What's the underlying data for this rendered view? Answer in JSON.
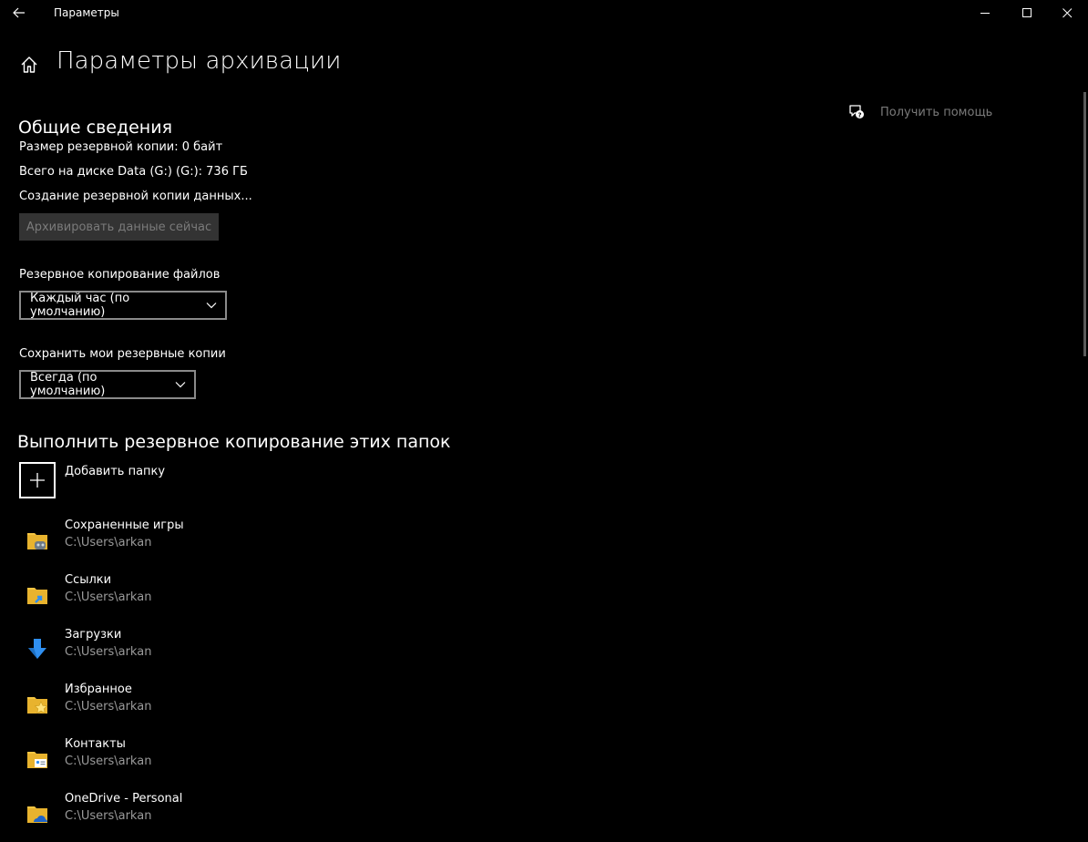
{
  "window": {
    "title": "Параметры",
    "controls": [
      "minimize-icon",
      "maximize-icon",
      "close-icon"
    ]
  },
  "header": {
    "title": "Параметры архивации",
    "home_icon": "home-icon"
  },
  "help": {
    "label": "Получить помощь",
    "icon": "help-chat-icon"
  },
  "overview": {
    "title": "Общие сведения",
    "backup_size": "Размер резервной копии: 0 байт",
    "disk_total": "Всего на диске Data (G:) (G:): 736 ГБ",
    "status": "Создание резервной копии данных...",
    "backup_now_button": "Архивировать данные сейчас"
  },
  "frequency": {
    "label": "Резервное копирование файлов",
    "selected": "Каждый час (по умолчанию)"
  },
  "retention": {
    "label": "Сохранить мои резервные копии",
    "selected": "Всегда (по умолчанию)"
  },
  "folders": {
    "title": "Выполнить резервное копирование этих папок",
    "add_label": "Добавить папку",
    "items": [
      {
        "name": "Сохраненные игры",
        "path": "C:\\Users\\arkan",
        "icon": "saved-games-folder-icon"
      },
      {
        "name": "Ссылки",
        "path": "C:\\Users\\arkan",
        "icon": "links-folder-icon"
      },
      {
        "name": "Загрузки",
        "path": "C:\\Users\\arkan",
        "icon": "downloads-arrow-icon"
      },
      {
        "name": "Избранное",
        "path": "C:\\Users\\arkan",
        "icon": "favorites-folder-icon"
      },
      {
        "name": "Контакты",
        "path": "C:\\Users\\arkan",
        "icon": "contacts-folder-icon"
      },
      {
        "name": "OneDrive - Personal",
        "path": "C:\\Users\\arkan",
        "icon": "onedrive-folder-icon"
      }
    ]
  },
  "colors": {
    "background": "#000000",
    "text": "#ffffff",
    "muted_text": "#9a9a9a",
    "disabled_button_bg": "#333333",
    "folder_yellow": "#f5c542",
    "download_blue": "#2f8ff0"
  }
}
